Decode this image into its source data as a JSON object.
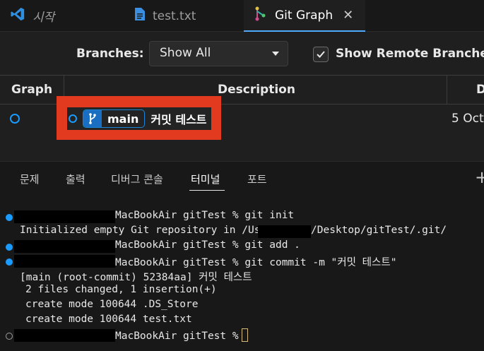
{
  "tabs": [
    {
      "label": "시작",
      "icon": "vscode-logo-icon"
    },
    {
      "label": "test.txt",
      "icon": "file-icon"
    },
    {
      "label": "Git Graph",
      "icon": "git-graph-icon",
      "active": true
    }
  ],
  "controls": {
    "branches_label": "Branches:",
    "branches_value": "Show All",
    "remote_label": "Show Remote Branches",
    "remote_checked": true
  },
  "table": {
    "headers": [
      "Graph",
      "Description",
      "Date"
    ],
    "rows": [
      {
        "branch": "main",
        "message": "커밋 테스트",
        "date": "5 Oct"
      }
    ]
  },
  "panel": {
    "tabs": [
      "문제",
      "출력",
      "디버그 콘솔",
      "터미널",
      "포트"
    ],
    "active_tab": "터미널"
  },
  "terminal": {
    "lines": [
      {
        "prompt": true,
        "text": "MacBookAir gitTest % git init"
      },
      {
        "prompt": false,
        "text_a": "Initialized empty Git repository in /Users",
        "text_b": "/Desktop/gitTest/.git/"
      },
      {
        "prompt": true,
        "text": "MacBookAir gitTest % git add ."
      },
      {
        "prompt": true,
        "text": "MacBookAir gitTest % git commit -m \"커밋 테스트\""
      },
      {
        "prompt": false,
        "text": "[main (root-commit) 52384aa] 커밋 테스트"
      },
      {
        "prompt": false,
        "text": "2 files changed, 1 insertion(+)"
      },
      {
        "prompt": false,
        "text": "create mode 100644 .DS_Store"
      },
      {
        "prompt": false,
        "text": "create mode 100644 test.txt"
      },
      {
        "prompt": true,
        "text": "MacBookAir gitTest %"
      }
    ]
  },
  "colors": {
    "accent": "#1a9bff",
    "highlight_border": "#e23a1f"
  }
}
